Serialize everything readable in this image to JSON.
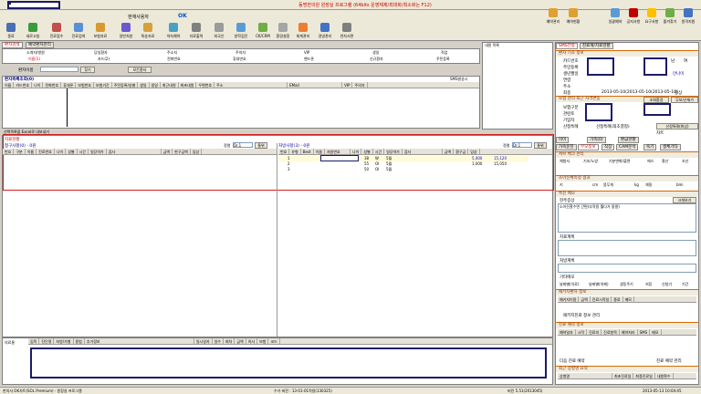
{
  "app": {
    "title": "동명한의원 원장실 프로그램 (64bits 운영체제/최대화/최소화는 F12)",
    "user_label": "현재사용자",
    "ok_label": "OK"
  },
  "titlebar_right": {
    "b1": "예약관리",
    "b2": "예약현황",
    "b3": "일괄예약",
    "b4": "공지사항",
    "b5": "요구사항",
    "b6": "즐겨찾기",
    "b7": "원격지원"
  },
  "toolbar": {
    "items": [
      "종료",
      "새로고침",
      "진료접수",
      "진료검색",
      "보험자료",
      "일반처방",
      "특송자료",
      "약속예약",
      "자료출력",
      "외국인",
      "방학검진",
      "CK/CRM",
      "환경설정",
      "회계관리",
      "경영관리",
      "연차서면"
    ]
  },
  "left_tabs": [
    "환자검색",
    "예약환자관리"
  ],
  "category_tabs": {
    "row1": [
      "소개자/병원",
      "당일환자",
      "주소지",
      "주의자",
      "VIP",
      "생일",
      "직업"
    ],
    "row2": [
      "이름(1)",
      "카드(2)",
      "전화번호",
      "휴대번호",
      "핸드폰",
      "신규환자",
      "주민등록"
    ]
  },
  "search": {
    "label": "환자이름",
    "button": "찾기",
    "button2": "모든환자"
  },
  "patient_list": {
    "title": "환자목록조회(0)",
    "sms": "SMS발송시",
    "columns": [
      "이름",
      "카드번호",
      "나이",
      "전화번호",
      "휴대폰",
      "보험번호",
      "보험기간",
      "주민등록/성별",
      "생일",
      "생일",
      "최근내원",
      "최초내원",
      "우편번호",
      "주소",
      "EMail",
      "VIP",
      "주의자"
    ],
    "footer": "선택목록을 Excel로 내보내기"
  },
  "mid_right": {
    "label": "내원 목록"
  },
  "treatment": {
    "header": "치료현황",
    "left_title": "청구사항(0) - 0원",
    "right_title": "처방사항(3) - 0원",
    "left_sort": "정렬",
    "left_sort_val": "Dr.1",
    "left_btn": "통위",
    "right_sort": "정렬",
    "right_sort_val": "Dr.1",
    "right_btn": "통위",
    "left_cols": [
      "번호",
      "구분",
      "이름",
      "진료번호",
      "나이",
      "성별",
      "시간",
      "일당약가",
      "검사",
      "금액",
      "한구금액",
      "임상"
    ],
    "right_cols": [
      "번호",
      "유형",
      "Best",
      "이름",
      "처방번호",
      "나이",
      "성별",
      "시간",
      "일당약가",
      "검사",
      "금액",
      "환구금",
      "임상"
    ],
    "rows": [
      {
        "no": "1",
        "code": "38",
        "unit": "W",
        "qty": "5월",
        "amount": "5,400",
        "total": "15,120"
      },
      {
        "no": "2",
        "code": "55",
        "unit": "OI",
        "qty": "5월",
        "amount": "1,000",
        "total": "15,050"
      },
      {
        "no": "3",
        "code": "50",
        "unit": "OI",
        "qty": "5월",
        "amount": "",
        "total": ""
      }
    ]
  },
  "lower": {
    "label": "의료물",
    "cols": [
      "임목",
      "진단명",
      "처방/가형",
      "용법",
      "추가정보",
      "일시일자",
      "일수",
      "회차",
      "금액",
      "의사",
      "보험",
      "코드"
    ]
  },
  "right_panel": {
    "sms_tab": "SMS전송",
    "tab2": "진료계/치료현황",
    "patient_section": "환자 기초 정보",
    "fields": {
      "card": "카드번호",
      "id": "주민등록",
      "birth": "생년월일",
      "visit": "연령",
      "addr": "주소",
      "last": "최종",
      "date_range": "2013-05-10(2013-05-10(2013-05-10)",
      "gender_m": "남",
      "gender_f": "여",
      "age_note": "만나이",
      "status": "정상"
    },
    "insurance_section": "보험 관리 최근 자격변동",
    "ins_btn": "조회환경",
    "ins_btn2": "무보/산재가",
    "ins_fields": [
      "보험구분",
      "관련토",
      "기입자",
      "산정특례",
      "선정특례(최초결정)",
      "차트"
    ],
    "ins_btn3": "선정특례(화상)",
    "tabs": [
      "이이",
      "가족(0)",
      "환급현황"
    ],
    "sub_tabs": [
      "가족문진",
      "부모정보",
      "직장",
      "CAM분석",
      "숙기",
      "생체기타"
    ],
    "c_section": "서브 체크 관리",
    "c_fields": [
      "체험서",
      "기조/노방",
      "기분변화/불면",
      "에스",
      "흉산",
      "조산"
    ],
    "body_section": "소아신체측정 결과",
    "body_fields": [
      "키",
      "cm",
      "몸무게",
      "kg",
      "체질",
      "bmi"
    ],
    "memo_section": "특진 메모",
    "memo_labels": [
      "현주증상",
      "치료계획",
      "처방계획",
      "기타메모"
    ],
    "memo_btn": "크게보기",
    "memo_placeholder": "소아진찰수면 간편(부작용 뭘다가 중팔)",
    "memo_bottom": [
      "날짜별(치료)",
      "날짜별(약제)",
      "생동주기",
      "저장",
      "신청기",
      "기간"
    ],
    "reg_section": "패키지환자 정보",
    "reg_fields": [
      "패키지이용",
      "금액",
      "진료시작일",
      "종료",
      "메모"
    ],
    "reg_btn": "패키지진료 정보 관리",
    "appt_section": "진료 예약 정보",
    "appt_cols": [
      "예약일자",
      "시작",
      "진료의",
      "진료항목",
      "예약처리",
      "SMS",
      "메모"
    ],
    "appt_btn": "다음 진료 예약",
    "appt_btn2": "진료 예약 관리",
    "record_section": "최근 상병명 요약",
    "record_cols": [
      "상병명",
      "최초진료일",
      "최종진료일",
      "내원횟수"
    ]
  },
  "status": {
    "left": "한의사 OK차트(SOL Premium) - 원장실 프로그램",
    "mid": "수가 버전 : 13-01-01적용(130325)",
    "right": "버전 5.51(2013045)",
    "date": "2013-05-13 10:04:45"
  }
}
